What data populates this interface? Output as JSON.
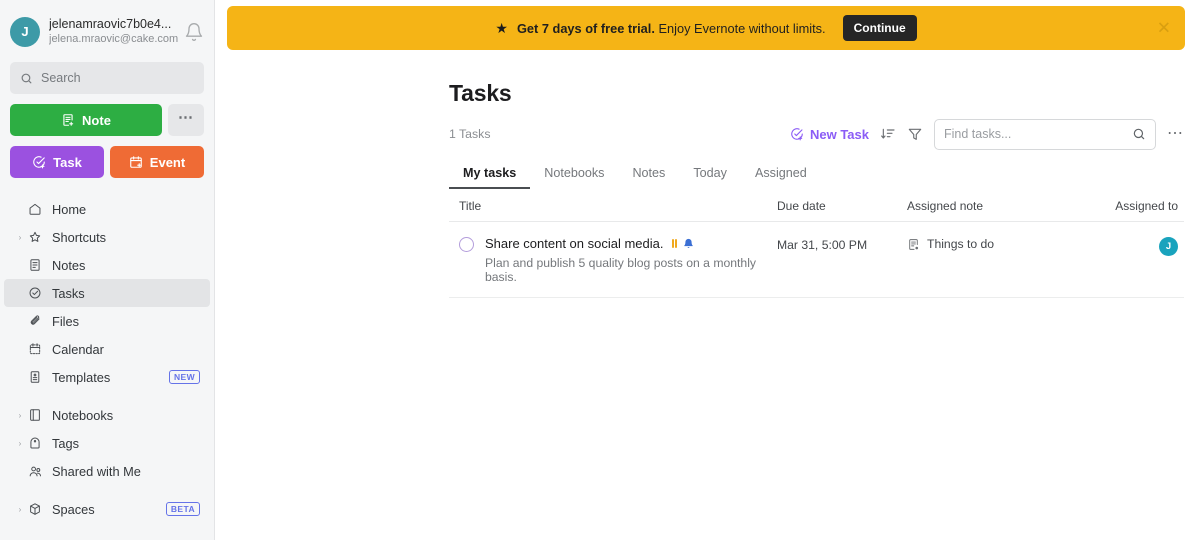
{
  "sidebar": {
    "account": {
      "avatar_initial": "J",
      "avatar_color": "#3d9aa7",
      "name": "jelenamraovic7b0e4...",
      "email": "jelena.mraovic@cake.com",
      "bell_icon": "bell-icon"
    },
    "search": {
      "placeholder": "Search",
      "icon": "search-icon"
    },
    "buttons": [
      {
        "label": "Note",
        "icon": "note-add-icon",
        "color": "#2dae43"
      },
      {
        "label": "⋯",
        "icon": "more-icon",
        "color": "#e6e7e9"
      },
      {
        "label": "Task",
        "icon": "task-add-icon",
        "color": "#9b51e0"
      },
      {
        "label": "Event",
        "icon": "calendar-add-icon",
        "color": "#ef6b35"
      }
    ],
    "nav": [
      {
        "label": "Home",
        "icon": "home-icon",
        "caret": false,
        "active": false,
        "badge": ""
      },
      {
        "label": "Shortcuts",
        "icon": "star-icon",
        "caret": true,
        "active": false,
        "badge": ""
      },
      {
        "label": "Notes",
        "icon": "note-icon",
        "caret": false,
        "active": false,
        "badge": ""
      },
      {
        "label": "Tasks",
        "icon": "task-circle-icon",
        "caret": false,
        "active": true,
        "badge": ""
      },
      {
        "label": "Files",
        "icon": "paperclip-icon",
        "caret": false,
        "active": false,
        "badge": ""
      },
      {
        "label": "Calendar",
        "icon": "calendar-icon",
        "caret": false,
        "active": false,
        "badge": ""
      },
      {
        "label": "Templates",
        "icon": "template-icon",
        "caret": false,
        "active": false,
        "badge": "NEW"
      },
      {
        "label": "Notebooks",
        "icon": "notebook-icon",
        "caret": true,
        "active": false,
        "badge": "",
        "gap_before": true
      },
      {
        "label": "Tags",
        "icon": "tag-icon",
        "caret": true,
        "active": false,
        "badge": ""
      },
      {
        "label": "Shared with Me",
        "icon": "shared-icon",
        "caret": false,
        "active": false,
        "badge": ""
      },
      {
        "label": "Spaces",
        "icon": "cube-icon",
        "caret": true,
        "active": false,
        "badge": "BETA",
        "gap_before": true
      }
    ],
    "badge_color": "#6573e8"
  },
  "banner": {
    "star_icon": "star-filled-icon",
    "text_bold": "Get 7 days of free trial.",
    "text_rest": " Enjoy Evernote without limits.",
    "button_label": "Continue",
    "close_icon": "close-icon",
    "background": "#f5b416"
  },
  "header": {
    "title": "Tasks",
    "count_label": "1 Tasks"
  },
  "toolbar": {
    "new_task_label": "New Task",
    "new_task_icon": "task-add-icon",
    "new_task_color": "#8b5cf6",
    "sort_icon": "sort-descending-icon",
    "filter_icon": "filter-funnel-icon",
    "search_placeholder": "Find tasks...",
    "search_value": "",
    "search_icon": "search-icon",
    "more_icon": "more-horizontal-icon"
  },
  "tabs": [
    {
      "label": "My tasks",
      "active": true
    },
    {
      "label": "Notebooks",
      "active": false
    },
    {
      "label": "Notes",
      "active": false
    },
    {
      "label": "Today",
      "active": false
    },
    {
      "label": "Assigned",
      "active": false
    }
  ],
  "table": {
    "columns": {
      "title": "Title",
      "due_date": "Due date",
      "assigned_note": "Assigned note",
      "assigned_to": "Assigned to"
    },
    "rows": [
      {
        "checkbox_icon": "unchecked-circle-icon",
        "title": "Share content on social media.",
        "priority_icon": "priority-high-icon",
        "priority_color": "#f0a91e",
        "reminder_icon": "bell-filled-icon",
        "reminder_color": "#3b6fd4",
        "description": "Plan and publish 5 quality blog posts on a monthly basis.",
        "due_date": "Mar 31, 5:00 PM",
        "assigned_note_icon": "note-icon",
        "assigned_note": "Things to do",
        "assigned_to_initial": "J",
        "assigned_to_color": "#19a3bd"
      }
    ]
  }
}
